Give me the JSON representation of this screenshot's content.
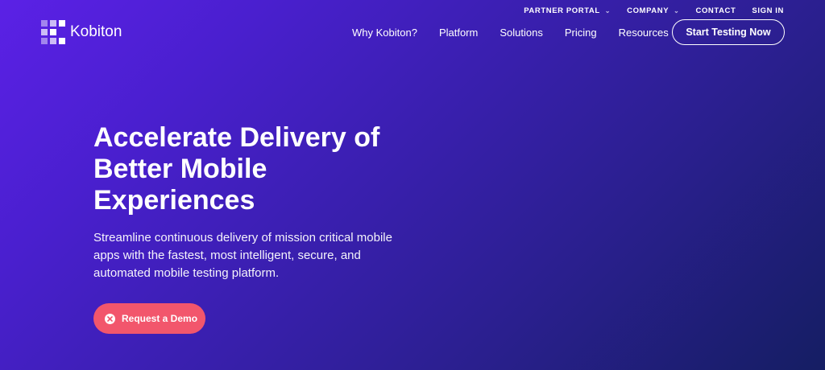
{
  "utility_nav": {
    "partner_portal": "PARTNER PORTAL",
    "company": "COMPANY",
    "contact": "CONTACT",
    "sign_in": "SIGN IN"
  },
  "brand": {
    "name": "Kobiton"
  },
  "main_nav": {
    "items": [
      "Why Kobiton?",
      "Platform",
      "Solutions",
      "Pricing",
      "Resources"
    ]
  },
  "header_cta": {
    "label": "Start Testing Now"
  },
  "hero": {
    "title_lines": [
      "Accelerate Delivery of",
      "Better Mobile",
      "Experiences"
    ],
    "subtitle_lines": [
      "Streamline continuous delivery of mission critical mobile",
      "apps with the fastest, most intelligent, secure, and",
      "automated mobile testing platform."
    ],
    "demo_button": "Request a Demo"
  },
  "colors": {
    "accent": "#f2566c",
    "gradient_start": "#5b21e6",
    "gradient_end": "#151e63"
  }
}
